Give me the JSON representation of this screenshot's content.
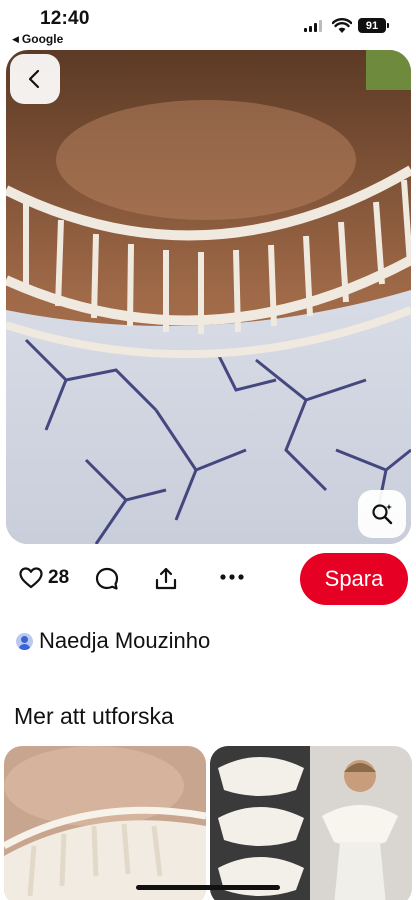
{
  "status_bar": {
    "time": "12:40",
    "back_app": "Google",
    "battery": "91",
    "icons": [
      "signal-icon",
      "wifi-icon",
      "battery-icon"
    ]
  },
  "pin": {
    "image_description_icon": "crochet-lace-yoke-photo",
    "back_icon": "chevron-left-icon",
    "lens_icon": "visual-search-icon"
  },
  "actions": {
    "like_count": "28",
    "icons": [
      "heart-icon",
      "comment-icon",
      "share-icon",
      "more-icon"
    ],
    "save_label": "Spara"
  },
  "creator": {
    "name": "Naedja Mouzinho"
  },
  "explore": {
    "title": "Mer att utforska"
  },
  "colors": {
    "accent": "#e60023",
    "text": "#111111",
    "background": "#ffffff"
  }
}
